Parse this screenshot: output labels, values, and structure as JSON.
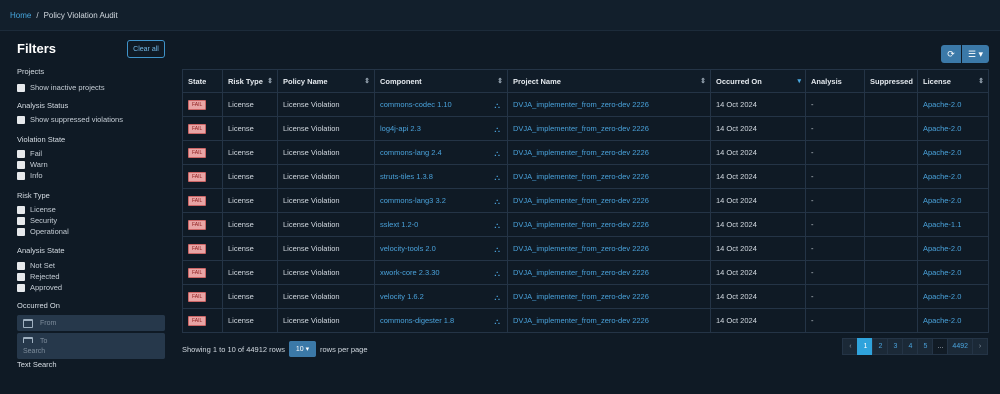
{
  "breadcrumb": {
    "home": "Home",
    "separator": "/",
    "current": "Policy Violation Audit"
  },
  "filters": {
    "title": "Filters",
    "clear_all": "Clear all",
    "projects": {
      "title": "Projects",
      "options": [
        "Show inactive projects"
      ]
    },
    "analysis_status": {
      "title": "Analysis Status",
      "options": [
        "Show suppressed violations"
      ]
    },
    "violation_state": {
      "title": "Violation State",
      "options": [
        "Fail",
        "Warn",
        "Info"
      ]
    },
    "risk_type": {
      "title": "Risk Type",
      "options": [
        "License",
        "Security",
        "Operational"
      ]
    },
    "analysis_state": {
      "title": "Analysis State",
      "options": [
        "Not Set",
        "Rejected",
        "Approved"
      ]
    },
    "occurred_on": {
      "title": "Occurred On",
      "from_placeholder": "From",
      "to_placeholder": "To"
    },
    "text_search": {
      "title": "Text Search",
      "placeholder": "Search"
    }
  },
  "toolbar": {
    "refresh_icon": "refresh-icon",
    "columns_icon": "list-icon"
  },
  "table": {
    "columns": [
      "State",
      "Risk Type",
      "Policy Name",
      "Component",
      "Project Name",
      "Occurred On",
      "Analysis",
      "Suppressed",
      "License"
    ],
    "sorted_column": "Occurred On",
    "rows": [
      {
        "state": "FAIL",
        "risk_type": "License",
        "policy": "License Violation",
        "component": "commons-codec 1.10",
        "project": "DVJA_implementer_from_zero-dev 2226",
        "occurred": "14 Oct 2024",
        "analysis": "-",
        "suppressed": "",
        "license": "Apache-2.0"
      },
      {
        "state": "FAIL",
        "risk_type": "License",
        "policy": "License Violation",
        "component": "log4j-api 2.3",
        "project": "DVJA_implementer_from_zero-dev 2226",
        "occurred": "14 Oct 2024",
        "analysis": "-",
        "suppressed": "",
        "license": "Apache-2.0"
      },
      {
        "state": "FAIL",
        "risk_type": "License",
        "policy": "License Violation",
        "component": "commons-lang 2.4",
        "project": "DVJA_implementer_from_zero-dev 2226",
        "occurred": "14 Oct 2024",
        "analysis": "-",
        "suppressed": "",
        "license": "Apache-2.0"
      },
      {
        "state": "FAIL",
        "risk_type": "License",
        "policy": "License Violation",
        "component": "struts-tiles 1.3.8",
        "project": "DVJA_implementer_from_zero-dev 2226",
        "occurred": "14 Oct 2024",
        "analysis": "-",
        "suppressed": "",
        "license": "Apache-2.0"
      },
      {
        "state": "FAIL",
        "risk_type": "License",
        "policy": "License Violation",
        "component": "commons-lang3 3.2",
        "project": "DVJA_implementer_from_zero-dev 2226",
        "occurred": "14 Oct 2024",
        "analysis": "-",
        "suppressed": "",
        "license": "Apache-2.0"
      },
      {
        "state": "FAIL",
        "risk_type": "License",
        "policy": "License Violation",
        "component": "sslext 1.2-0",
        "project": "DVJA_implementer_from_zero-dev 2226",
        "occurred": "14 Oct 2024",
        "analysis": "-",
        "suppressed": "",
        "license": "Apache-1.1"
      },
      {
        "state": "FAIL",
        "risk_type": "License",
        "policy": "License Violation",
        "component": "velocity-tools 2.0",
        "project": "DVJA_implementer_from_zero-dev 2226",
        "occurred": "14 Oct 2024",
        "analysis": "-",
        "suppressed": "",
        "license": "Apache-2.0"
      },
      {
        "state": "FAIL",
        "risk_type": "License",
        "policy": "License Violation",
        "component": "xwork-core 2.3.30",
        "project": "DVJA_implementer_from_zero-dev 2226",
        "occurred": "14 Oct 2024",
        "analysis": "-",
        "suppressed": "",
        "license": "Apache-2.0"
      },
      {
        "state": "FAIL",
        "risk_type": "License",
        "policy": "License Violation",
        "component": "velocity 1.6.2",
        "project": "DVJA_implementer_from_zero-dev 2226",
        "occurred": "14 Oct 2024",
        "analysis": "-",
        "suppressed": "",
        "license": "Apache-2.0"
      },
      {
        "state": "FAIL",
        "risk_type": "License",
        "policy": "License Violation",
        "component": "commons-digester 1.8",
        "project": "DVJA_implementer_from_zero-dev 2226",
        "occurred": "14 Oct 2024",
        "analysis": "-",
        "suppressed": "",
        "license": "Apache-2.0"
      }
    ]
  },
  "footer": {
    "showing": "Showing 1 to 10 of 44912 rows",
    "rows_per_page_value": "10",
    "rows_per_page_label": "rows per page"
  },
  "pagination": {
    "prev": "‹",
    "pages": [
      "1",
      "2",
      "3",
      "4",
      "5"
    ],
    "ellipsis": "...",
    "last": "4492",
    "next": "›",
    "active": "1"
  },
  "colors": {
    "accent": "#2fa3dc",
    "background": "#0f1a25",
    "fail_badge": "#e8a5a5"
  }
}
